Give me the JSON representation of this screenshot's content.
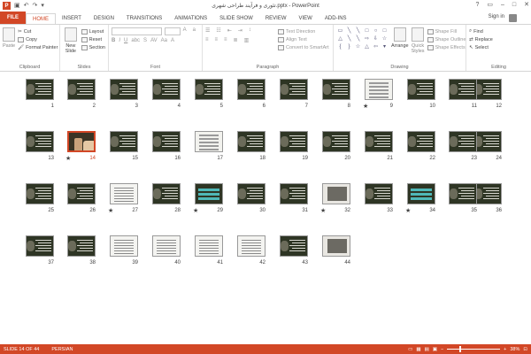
{
  "window": {
    "title": "تئوری و فرآیند طراحی شهری.pptx - PowerPoint",
    "sign_in": "Sign in"
  },
  "tabs": [
    "FILE",
    "HOME",
    "INSERT",
    "DESIGN",
    "TRANSITIONS",
    "ANIMATIONS",
    "SLIDE SHOW",
    "REVIEW",
    "VIEW",
    "ADD-INS"
  ],
  "ribbon": {
    "clipboard": {
      "label": "Clipboard",
      "paste": "Paste",
      "cut": "Cut",
      "copy": "Copy",
      "format_painter": "Format Painter"
    },
    "slides": {
      "label": "Slides",
      "new_slide": "New",
      "new_slide2": "Slide",
      "layout": "Layout",
      "reset": "Reset",
      "section": "Section"
    },
    "font": {
      "label": "Font",
      "bold": "B",
      "italic": "I",
      "underline": "U",
      "strike": "S",
      "shadow": "abc",
      "spacing": "AV",
      "case": "Aa",
      "color": "A"
    },
    "paragraph": {
      "label": "Paragraph",
      "text_direction": "Text Direction",
      "align_text": "Align Text",
      "convert_smartart": "Convert to SmartArt"
    },
    "drawing": {
      "label": "Drawing",
      "arrange": "Arrange",
      "quick_styles": "Quick",
      "quick_styles2": "Styles",
      "shape_fill": "Shape Fill",
      "shape_outline": "Shape Outline",
      "shape_effects": "Shape Effects"
    },
    "editing": {
      "label": "Editing",
      "find": "Find",
      "replace": "Replace",
      "select": "Select"
    }
  },
  "slides": [
    {
      "n": "12",
      "s": "dark"
    },
    {
      "n": "11",
      "s": "dark"
    },
    {
      "n": "10",
      "s": "dark"
    },
    {
      "n": "9",
      "s": "table",
      "star": true
    },
    {
      "n": "8",
      "s": "dark"
    },
    {
      "n": "7",
      "s": "dark"
    },
    {
      "n": "6",
      "s": "dark"
    },
    {
      "n": "5",
      "s": "dark"
    },
    {
      "n": "4",
      "s": "dark"
    },
    {
      "n": "3",
      "s": "dark"
    },
    {
      "n": "2",
      "s": "dark"
    },
    {
      "n": "1",
      "s": "dark"
    },
    {
      "n": "24",
      "s": "dark"
    },
    {
      "n": "23",
      "s": "dark"
    },
    {
      "n": "22",
      "s": "dark"
    },
    {
      "n": "21",
      "s": "dark"
    },
    {
      "n": "20",
      "s": "dark"
    },
    {
      "n": "19",
      "s": "dark"
    },
    {
      "n": "18",
      "s": "dark"
    },
    {
      "n": "17",
      "s": "table"
    },
    {
      "n": "16",
      "s": "dark"
    },
    {
      "n": "15",
      "s": "dark"
    },
    {
      "n": "14",
      "s": "sel14",
      "star": true,
      "selected": true
    },
    {
      "n": "13",
      "s": "dark"
    },
    {
      "n": "36",
      "s": "dark"
    },
    {
      "n": "35",
      "s": "dark"
    },
    {
      "n": "34",
      "s": "teal",
      "star": true
    },
    {
      "n": "33",
      "s": "dark"
    },
    {
      "n": "32",
      "s": "photo",
      "star": true
    },
    {
      "n": "31",
      "s": "dark"
    },
    {
      "n": "30",
      "s": "dark"
    },
    {
      "n": "29",
      "s": "teal",
      "star": true
    },
    {
      "n": "28",
      "s": "dark"
    },
    {
      "n": "27",
      "s": "light",
      "star": true
    },
    {
      "n": "26",
      "s": "dark"
    },
    {
      "n": "25",
      "s": "dark"
    },
    {
      "n": "44",
      "s": "photo"
    },
    {
      "n": "43",
      "s": "dark"
    },
    {
      "n": "42",
      "s": "light"
    },
    {
      "n": "41",
      "s": "light"
    },
    {
      "n": "40",
      "s": "light"
    },
    {
      "n": "39",
      "s": "light"
    },
    {
      "n": "38",
      "s": "dark"
    },
    {
      "n": "37",
      "s": "dark"
    }
  ],
  "status": {
    "slide": "SLIDE 14 OF 44",
    "language": "PERSIAN",
    "zoom": "38%",
    "minus": "−",
    "plus": "+"
  },
  "icons": {
    "logo": "powerpoint-logo",
    "save": "save-icon",
    "undo": "undo-icon",
    "redo": "redo-icon"
  }
}
